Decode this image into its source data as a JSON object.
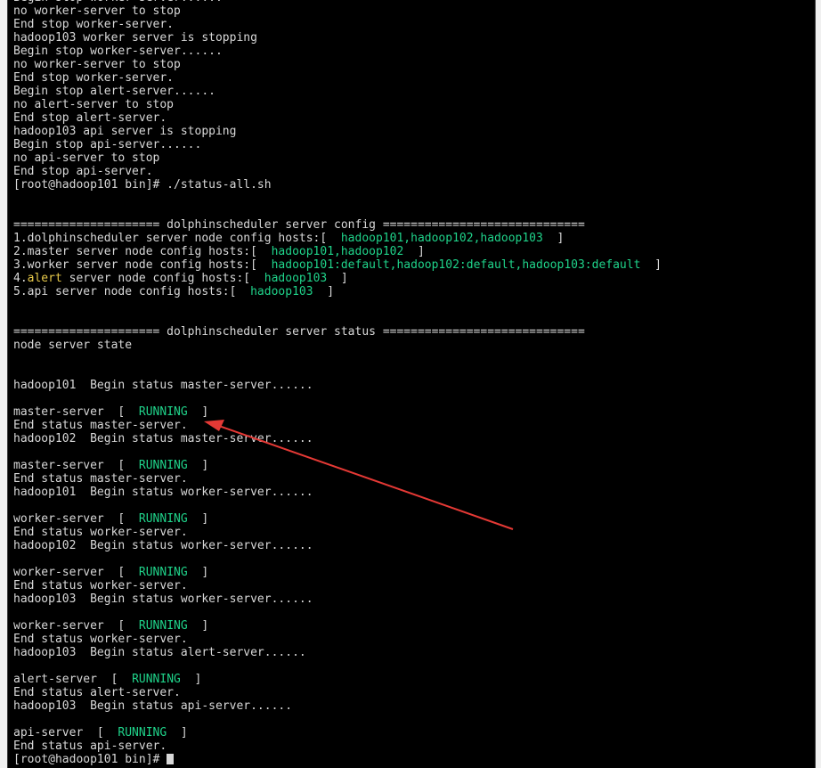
{
  "colors": {
    "background": "#000000",
    "text": "#d8d8d8",
    "highlight": "#1fd38a",
    "warning": "#e6c84a",
    "annotation_arrow": "#e53935"
  },
  "terminal": {
    "lines": [
      {
        "segments": [
          {
            "t": "Begin stop worker-server......"
          }
        ]
      },
      {
        "segments": [
          {
            "t": "no worker-server to stop"
          }
        ]
      },
      {
        "segments": [
          {
            "t": "End stop worker-server."
          }
        ]
      },
      {
        "segments": [
          {
            "t": "hadoop103 worker server is stopping"
          }
        ]
      },
      {
        "segments": [
          {
            "t": "Begin stop worker-server......"
          }
        ]
      },
      {
        "segments": [
          {
            "t": "no worker-server to stop"
          }
        ]
      },
      {
        "segments": [
          {
            "t": "End stop worker-server."
          }
        ]
      },
      {
        "segments": [
          {
            "t": "Begin stop alert-server......"
          }
        ]
      },
      {
        "segments": [
          {
            "t": "no alert-server to stop"
          }
        ]
      },
      {
        "segments": [
          {
            "t": "End stop alert-server."
          }
        ]
      },
      {
        "segments": [
          {
            "t": "hadoop103 api server is stopping"
          }
        ]
      },
      {
        "segments": [
          {
            "t": "Begin stop api-server......"
          }
        ]
      },
      {
        "segments": [
          {
            "t": "no api-server to stop"
          }
        ]
      },
      {
        "segments": [
          {
            "t": "End stop api-server."
          }
        ]
      },
      {
        "segments": [
          {
            "t": "[root@hadoop101 bin]# ./status-all.sh"
          }
        ]
      },
      {
        "segments": [
          {
            "t": ""
          }
        ]
      },
      {
        "segments": [
          {
            "t": ""
          }
        ]
      },
      {
        "segments": [
          {
            "t": "===================== dolphinscheduler server config ============================="
          }
        ]
      },
      {
        "segments": [
          {
            "t": "1.dolphinscheduler server node config hosts:[  "
          },
          {
            "t": "hadoop101,hadoop102,hadoop103",
            "c": "hl"
          },
          {
            "t": "  ]"
          }
        ]
      },
      {
        "segments": [
          {
            "t": "2.master server node config hosts:[  "
          },
          {
            "t": "hadoop101,hadoop102",
            "c": "hl"
          },
          {
            "t": "  ]"
          }
        ]
      },
      {
        "segments": [
          {
            "t": "3.worker server node config hosts:[  "
          },
          {
            "t": "hadoop101:default,hadoop102:default,hadoop103:default",
            "c": "hl"
          },
          {
            "t": "  ]"
          }
        ]
      },
      {
        "segments": [
          {
            "t": "4."
          },
          {
            "t": "alert",
            "c": "warn"
          },
          {
            "t": " server node config hosts:[  "
          },
          {
            "t": "hadoop103",
            "c": "hl"
          },
          {
            "t": "  ]"
          }
        ]
      },
      {
        "segments": [
          {
            "t": "5.api server node config hosts:[  "
          },
          {
            "t": "hadoop103",
            "c": "hl"
          },
          {
            "t": "  ]"
          }
        ]
      },
      {
        "segments": [
          {
            "t": ""
          }
        ]
      },
      {
        "segments": [
          {
            "t": ""
          }
        ]
      },
      {
        "segments": [
          {
            "t": "===================== dolphinscheduler server status ============================="
          }
        ]
      },
      {
        "segments": [
          {
            "t": "node server state"
          }
        ]
      },
      {
        "segments": [
          {
            "t": ""
          }
        ]
      },
      {
        "segments": [
          {
            "t": ""
          }
        ]
      },
      {
        "segments": [
          {
            "t": "hadoop101  Begin status master-server......"
          }
        ]
      },
      {
        "segments": [
          {
            "t": ""
          }
        ]
      },
      {
        "segments": [
          {
            "t": "master-server  [  "
          },
          {
            "t": "RUNNING",
            "c": "hl"
          },
          {
            "t": "  ]"
          }
        ]
      },
      {
        "segments": [
          {
            "t": "End status master-server."
          }
        ]
      },
      {
        "segments": [
          {
            "t": "hadoop102  Begin status master-server......"
          }
        ]
      },
      {
        "segments": [
          {
            "t": ""
          }
        ]
      },
      {
        "segments": [
          {
            "t": "master-server  [  "
          },
          {
            "t": "RUNNING",
            "c": "hl"
          },
          {
            "t": "  ]"
          }
        ]
      },
      {
        "segments": [
          {
            "t": "End status master-server."
          }
        ]
      },
      {
        "segments": [
          {
            "t": "hadoop101  Begin status worker-server......"
          }
        ]
      },
      {
        "segments": [
          {
            "t": ""
          }
        ]
      },
      {
        "segments": [
          {
            "t": "worker-server  [  "
          },
          {
            "t": "RUNNING",
            "c": "hl"
          },
          {
            "t": "  ]"
          }
        ]
      },
      {
        "segments": [
          {
            "t": "End status worker-server."
          }
        ]
      },
      {
        "segments": [
          {
            "t": "hadoop102  Begin status worker-server......"
          }
        ]
      },
      {
        "segments": [
          {
            "t": ""
          }
        ]
      },
      {
        "segments": [
          {
            "t": "worker-server  [  "
          },
          {
            "t": "RUNNING",
            "c": "hl"
          },
          {
            "t": "  ]"
          }
        ]
      },
      {
        "segments": [
          {
            "t": "End status worker-server."
          }
        ]
      },
      {
        "segments": [
          {
            "t": "hadoop103  Begin status worker-server......"
          }
        ]
      },
      {
        "segments": [
          {
            "t": ""
          }
        ]
      },
      {
        "segments": [
          {
            "t": "worker-server  [  "
          },
          {
            "t": "RUNNING",
            "c": "hl"
          },
          {
            "t": "  ]"
          }
        ]
      },
      {
        "segments": [
          {
            "t": "End status worker-server."
          }
        ]
      },
      {
        "segments": [
          {
            "t": "hadoop103  Begin status alert-server......"
          }
        ]
      },
      {
        "segments": [
          {
            "t": ""
          }
        ]
      },
      {
        "segments": [
          {
            "t": "alert-server  [  "
          },
          {
            "t": "RUNNING",
            "c": "hl"
          },
          {
            "t": "  ]"
          }
        ]
      },
      {
        "segments": [
          {
            "t": "End status alert-server."
          }
        ]
      },
      {
        "segments": [
          {
            "t": "hadoop103  Begin status api-server......"
          }
        ]
      },
      {
        "segments": [
          {
            "t": ""
          }
        ]
      },
      {
        "segments": [
          {
            "t": "api-server  [  "
          },
          {
            "t": "RUNNING",
            "c": "hl"
          },
          {
            "t": "  ]"
          }
        ]
      },
      {
        "segments": [
          {
            "t": "End status api-server."
          }
        ]
      },
      {
        "segments": [
          {
            "t": "[root@hadoop101 bin]# "
          }
        ],
        "cursor": true
      }
    ]
  }
}
